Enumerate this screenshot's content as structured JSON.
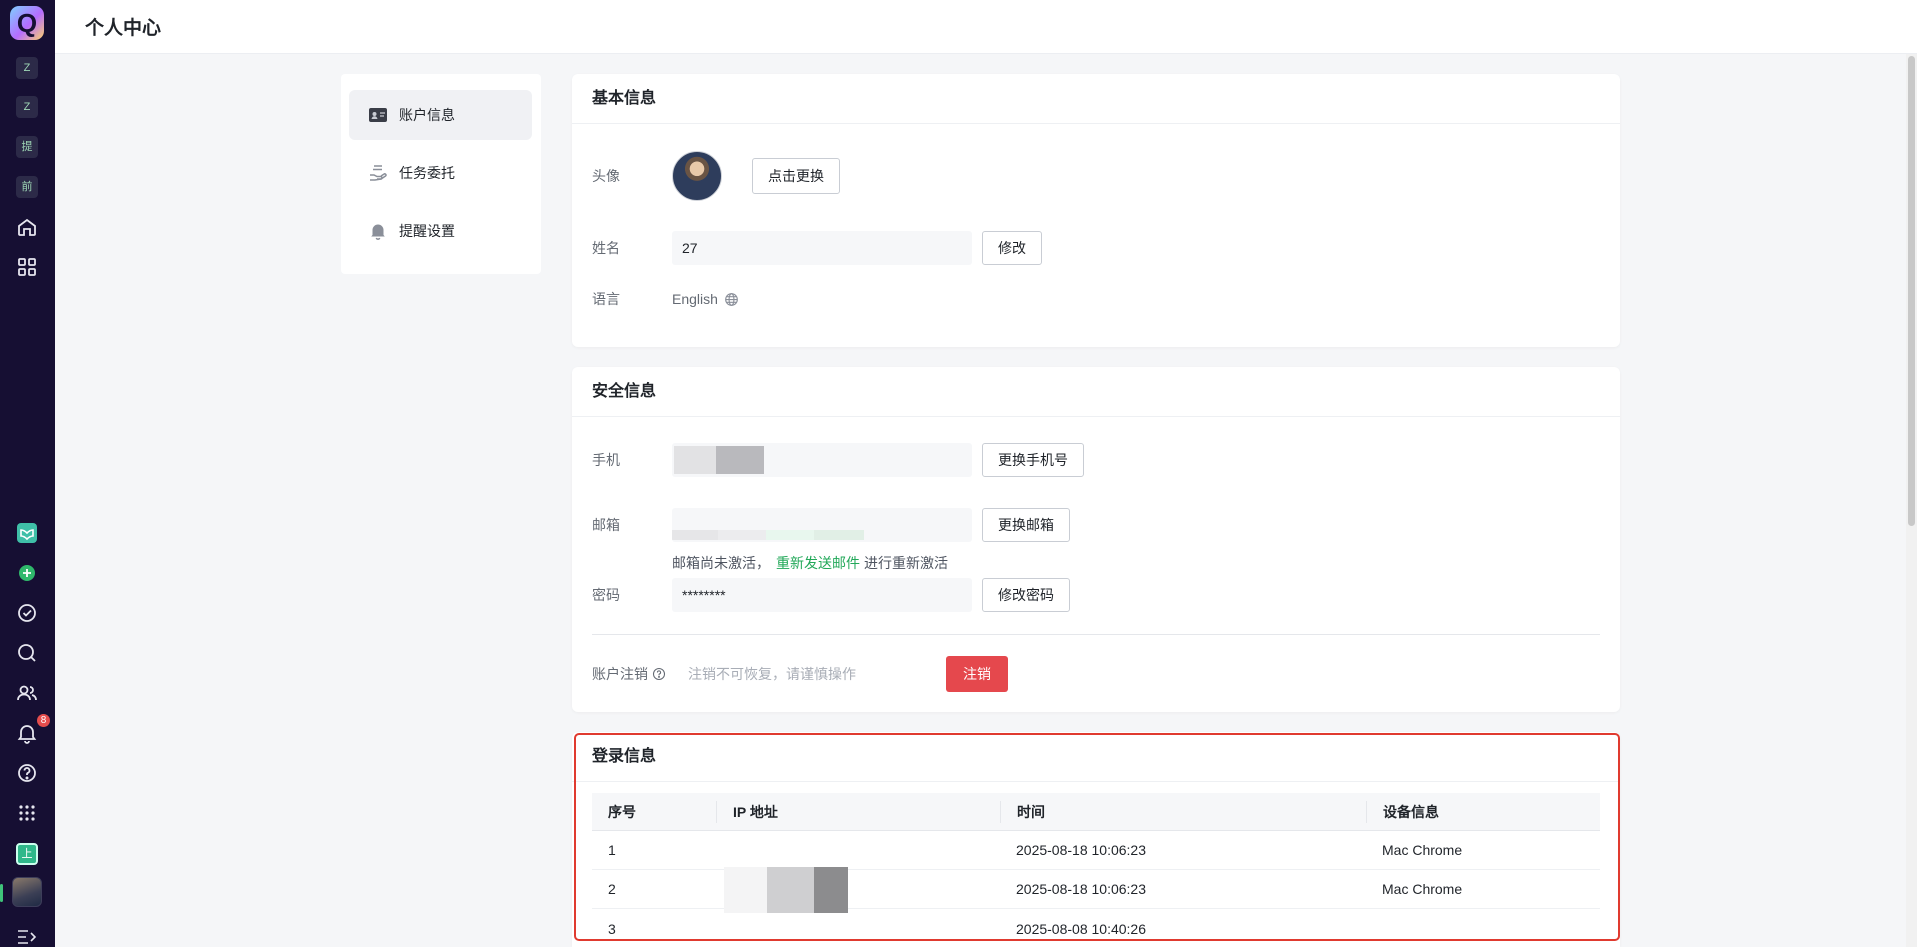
{
  "app": {
    "logo_letter": "Q",
    "rail_chips": [
      "Z",
      "Z",
      "提",
      "前"
    ],
    "notification_count": "8",
    "bottom_chip": "上"
  },
  "header": {
    "title": "个人中心"
  },
  "subnav": {
    "items": [
      {
        "label": "账户信息",
        "icon": "id-card-icon",
        "active": true
      },
      {
        "label": "任务委托",
        "icon": "hand-stack-icon",
        "active": false
      },
      {
        "label": "提醒设置",
        "icon": "bell-icon",
        "active": false
      }
    ]
  },
  "basic": {
    "title": "基本信息",
    "avatar_label": "头像",
    "change_avatar_button": "点击更换",
    "name_label": "姓名",
    "name_value": "27",
    "edit_name_button": "修改",
    "language_label": "语言",
    "language_value": "English"
  },
  "security": {
    "title": "安全信息",
    "phone_label": "手机",
    "change_phone_button": "更换手机号",
    "email_label": "邮箱",
    "change_email_button": "更换邮箱",
    "email_note_prefix": "邮箱尚未激活，",
    "email_resend_link": "重新发送邮件",
    "email_note_suffix": "进行重新激活",
    "password_label": "密码",
    "password_value": "********",
    "change_password_button": "修改密码",
    "deactivate_label": "账户注销",
    "deactivate_hint": "注销不可恢复，请谨慎操作",
    "deactivate_button": "注销"
  },
  "login": {
    "title": "登录信息",
    "columns": [
      "序号",
      "IP 地址",
      "时间",
      "设备信息"
    ],
    "rows": [
      {
        "index": "1",
        "ip": "",
        "time": "2025-08-18 10:06:23",
        "device": "Mac Chrome"
      },
      {
        "index": "2",
        "ip": "",
        "time": "2025-08-18 10:06:23",
        "device": "Mac Chrome"
      },
      {
        "index": "3",
        "ip": "",
        "time": "2025-08-08 10:40:26",
        "device": ""
      }
    ]
  }
}
